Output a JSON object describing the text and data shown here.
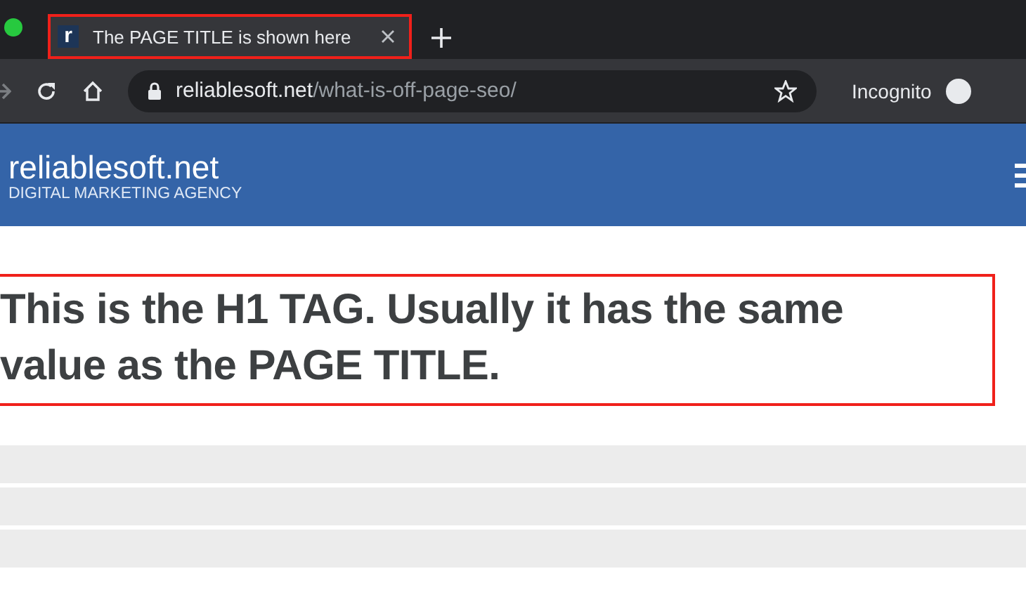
{
  "browser": {
    "tab": {
      "title": "The PAGE TITLE is shown here",
      "favicon": "r",
      "selected": true,
      "highlighted": true
    },
    "address": {
      "domain": "reliablesoft.net",
      "path": "/what-is-off-page-seo/"
    },
    "profile": "Incognito"
  },
  "site_header": {
    "logo": "reliablesoft.net",
    "tagline": "DIGITAL MARKETING AGENCY"
  },
  "heading": {
    "text": "This is the H1 TAG. Usually it has the same value as the PAGE TITLE.",
    "highlighted": true
  },
  "placeholder_rows": [
    {
      "kind": "bar"
    },
    {
      "kind": "bar"
    },
    {
      "kind": "bar"
    }
  ]
}
